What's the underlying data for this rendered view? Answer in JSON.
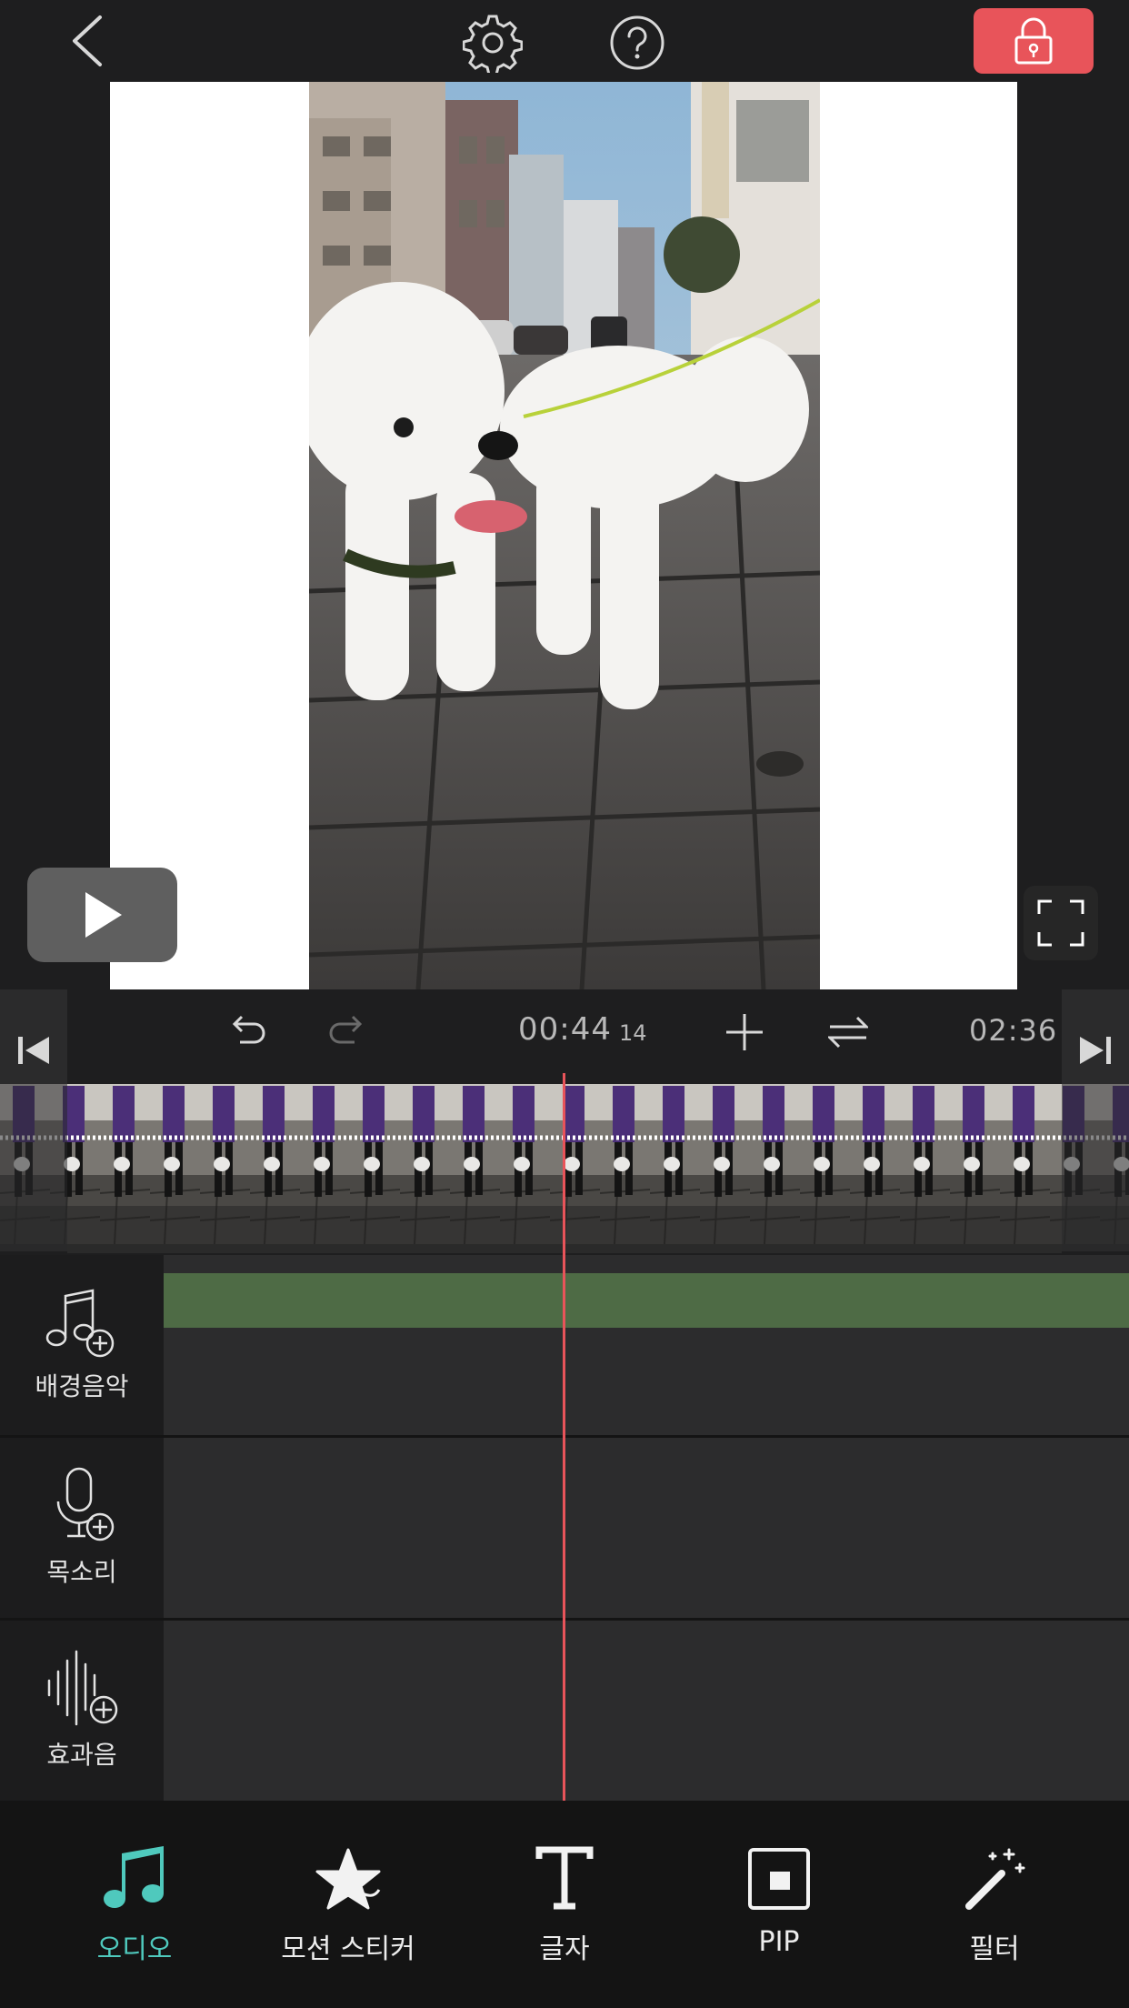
{
  "header": {
    "back": "back-icon",
    "settings": "gear-icon",
    "help": "help-icon",
    "lock": "lock-icon",
    "lock_color": "#e8545a"
  },
  "preview": {
    "play": "play-icon",
    "fullscreen": "fullscreen-icon"
  },
  "timeline": {
    "current_time": "00:44",
    "current_frames": "14",
    "total_time": "02:36",
    "undo": "undo-icon",
    "redo": "redo-icon",
    "add": "plus-icon",
    "swap": "swap-icon",
    "playhead_color": "#e8545a"
  },
  "tracks": [
    {
      "label": "배경음악",
      "icon": "music-add-icon",
      "clip_color": "#4e6b45"
    },
    {
      "label": "목소리",
      "icon": "mic-add-icon"
    },
    {
      "label": "효과음",
      "icon": "sound-effect-add-icon"
    }
  ],
  "toolbar": {
    "items": [
      {
        "label": "오디오",
        "icon": "music-note-icon",
        "active": true
      },
      {
        "label": "모션 스티커",
        "icon": "star-icon",
        "active": false
      },
      {
        "label": "글자",
        "icon": "text-icon",
        "active": false
      },
      {
        "label": "PIP",
        "icon": "pip-icon",
        "active": false
      },
      {
        "label": "필터",
        "icon": "magic-wand-icon",
        "active": false
      }
    ],
    "active_color": "#4fc9bd"
  }
}
